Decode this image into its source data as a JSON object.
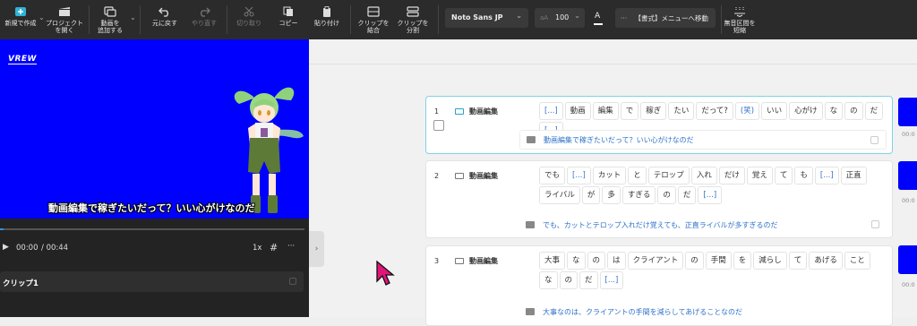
{
  "toolbar": {
    "new_project": "新規で作成",
    "open_project": "プロジェクト\nを開く",
    "add_video": "動画を\n追加する",
    "undo": "元に戻す",
    "redo": "やり直す",
    "cut": "切り取り",
    "copy": "コピー",
    "paste": "貼り付け",
    "merge_clip": "クリップを\n結合",
    "split_clip": "クリップを\n分割",
    "font_name": "Noto Sans JP",
    "font_size": "100",
    "format_menu": "【書式】メニューへ移動",
    "shorten_silence": "無音区間を\n短縮"
  },
  "preview": {
    "watermark": "VREW",
    "subtitle": "動画編集で稼ぎたいだって？いい心がけなのだ",
    "time_current": "00:00",
    "time_total": "/ 00:44",
    "speed": "1x",
    "clip_name": "クリップ1"
  },
  "clips": [
    {
      "number": "1",
      "label": "動画編集",
      "words": [
        "[...]",
        "動画",
        "編集",
        "で",
        "稼ぎ",
        "たい",
        "だって?",
        "(笑)",
        "いい",
        "心がけ",
        "な",
        "の",
        "だ",
        "[...]"
      ],
      "subtitle": "動画編集で稼ぎたいだって？いい心がけなのだ"
    },
    {
      "number": "2",
      "label": "動画編集",
      "words": [
        "でも",
        "[...]",
        "カット",
        "と",
        "テロップ",
        "入れ",
        "だけ",
        "覚え",
        "て",
        "も",
        "[...]",
        "正直",
        "ライバル",
        "が",
        "多",
        "すぎる",
        "の",
        "だ",
        "[...]"
      ],
      "subtitle": "でも、カットとテロップ入れだけ覚えても、正直ライバルが多すぎるのだ"
    },
    {
      "number": "3",
      "label": "動画編集",
      "words": [
        "大事",
        "な",
        "の",
        "は",
        "クライアント",
        "の",
        "手間",
        "を",
        "減らし",
        "て",
        "あげる",
        "こと",
        "な",
        "の",
        "だ",
        "[...]"
      ],
      "subtitle": "大事なのは、クライアントの手間を減らしてあげることなのだ"
    }
  ],
  "thumb_times": [
    "00:0",
    "00:0",
    "00:0"
  ],
  "colors": {
    "toolbar_bg": "#2b2b2b",
    "preview_bg": "#0000ff",
    "accent_blue": "#2e72c9",
    "active_border": "#7fd3e8",
    "cursor": "#e0157a"
  }
}
